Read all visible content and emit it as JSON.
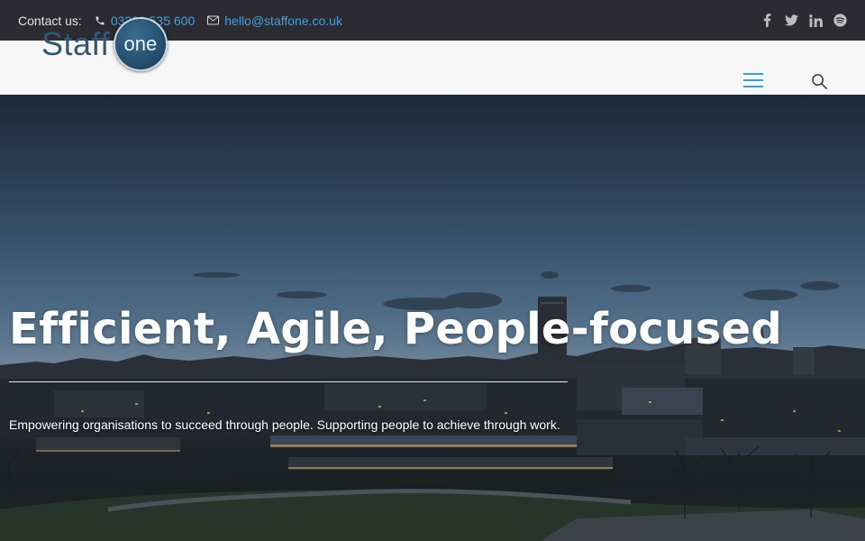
{
  "topbar": {
    "contact_label": "Contact us:",
    "phone": "03300 535 600",
    "email": "hello@staffone.co.uk",
    "phone_icon": "phone-icon",
    "email_icon": "envelope-icon",
    "social_icons": [
      "facebook-icon",
      "twitter-icon",
      "linkedin-icon",
      "spotify-icon"
    ]
  },
  "header": {
    "logo_word": "Staff",
    "logo_badge": "one",
    "menu_icon": "hamburger-menu-icon",
    "search_icon": "search-icon"
  },
  "hero": {
    "title": "Efficient, Agile, People-focused",
    "subtitle": "Empowering organisations to succeed through people. Supporting people to achieve through work."
  },
  "colors": {
    "topbar_bg": "#2b2b31",
    "link": "#3fa3e0",
    "header_bg": "#f6f6f6",
    "logo_blue": "#2f5876",
    "menu_blue": "#3aa0d8"
  }
}
